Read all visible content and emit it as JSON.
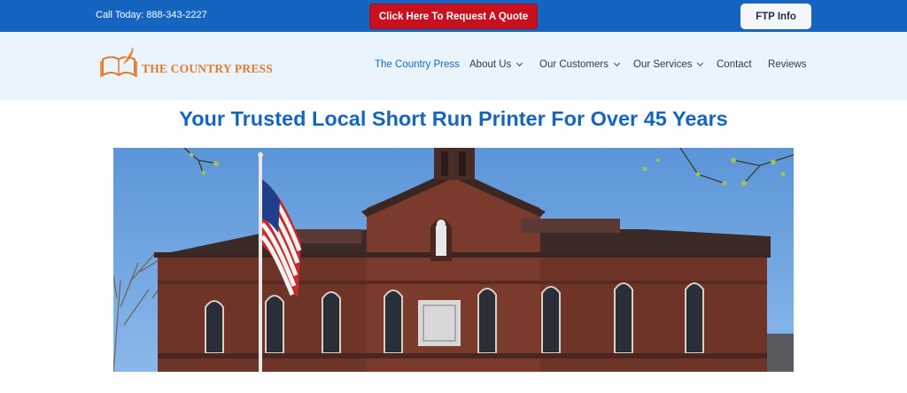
{
  "topbar": {
    "phone": "Call Today: 888-343-2227",
    "quote_button": "Click Here To Request A Quote",
    "ftp_button": "FTP Info"
  },
  "logo": {
    "text": "THE COUNTRY PRESS"
  },
  "nav": {
    "items": [
      {
        "label": "The Country Press",
        "dropdown": false,
        "active": true
      },
      {
        "label": "About Us",
        "dropdown": true
      },
      {
        "label": "Our Customers",
        "dropdown": true
      },
      {
        "label": "Our Services",
        "dropdown": true
      },
      {
        "label": "Contact",
        "dropdown": false
      },
      {
        "label": "Reviews",
        "dropdown": false
      }
    ]
  },
  "hero": {
    "title": "Your Trusted Local Short Run Printer For Over 45 Years"
  },
  "colors": {
    "accent": "#1565c0",
    "cta": "#c8101f",
    "logo": "#e07b2e",
    "header_bg": "#eaf4fd"
  }
}
